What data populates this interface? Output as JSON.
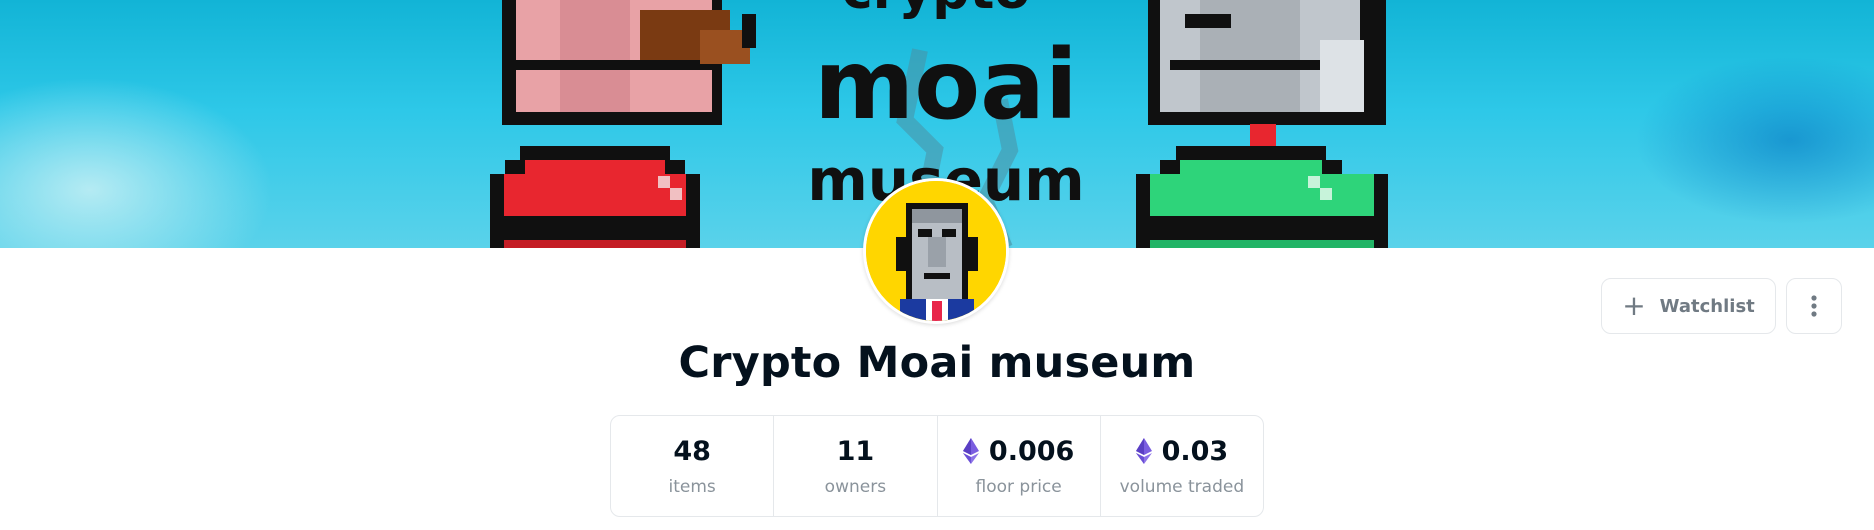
{
  "collection": {
    "title": "Crypto Moai museum",
    "avatar_icon": "moai-avatar-icon",
    "banner_icon": "crypto-moai-museum-banner"
  },
  "banner": {
    "logo_text_line1": "moai",
    "logo_text_line2": "museum",
    "logo_text_top": "crypto"
  },
  "actions": {
    "watchlist_label": "Watchlist",
    "watchlist_icon": "plus-icon",
    "more_icon": "more-vertical-icon"
  },
  "stats": [
    {
      "value": "48",
      "label": "items",
      "icon": ""
    },
    {
      "value": "11",
      "label": "owners",
      "icon": ""
    },
    {
      "value": "0.006",
      "label": "floor price",
      "icon": "ethereum-icon"
    },
    {
      "value": "0.03",
      "label": "volume traded",
      "icon": "ethereum-icon"
    }
  ],
  "colors": {
    "text_primary": "#04111d",
    "text_secondary": "#8a939b",
    "border": "#e5e8eb",
    "eth_purple": "#6a4fd6",
    "banner_blue": "#2ec8e8"
  }
}
